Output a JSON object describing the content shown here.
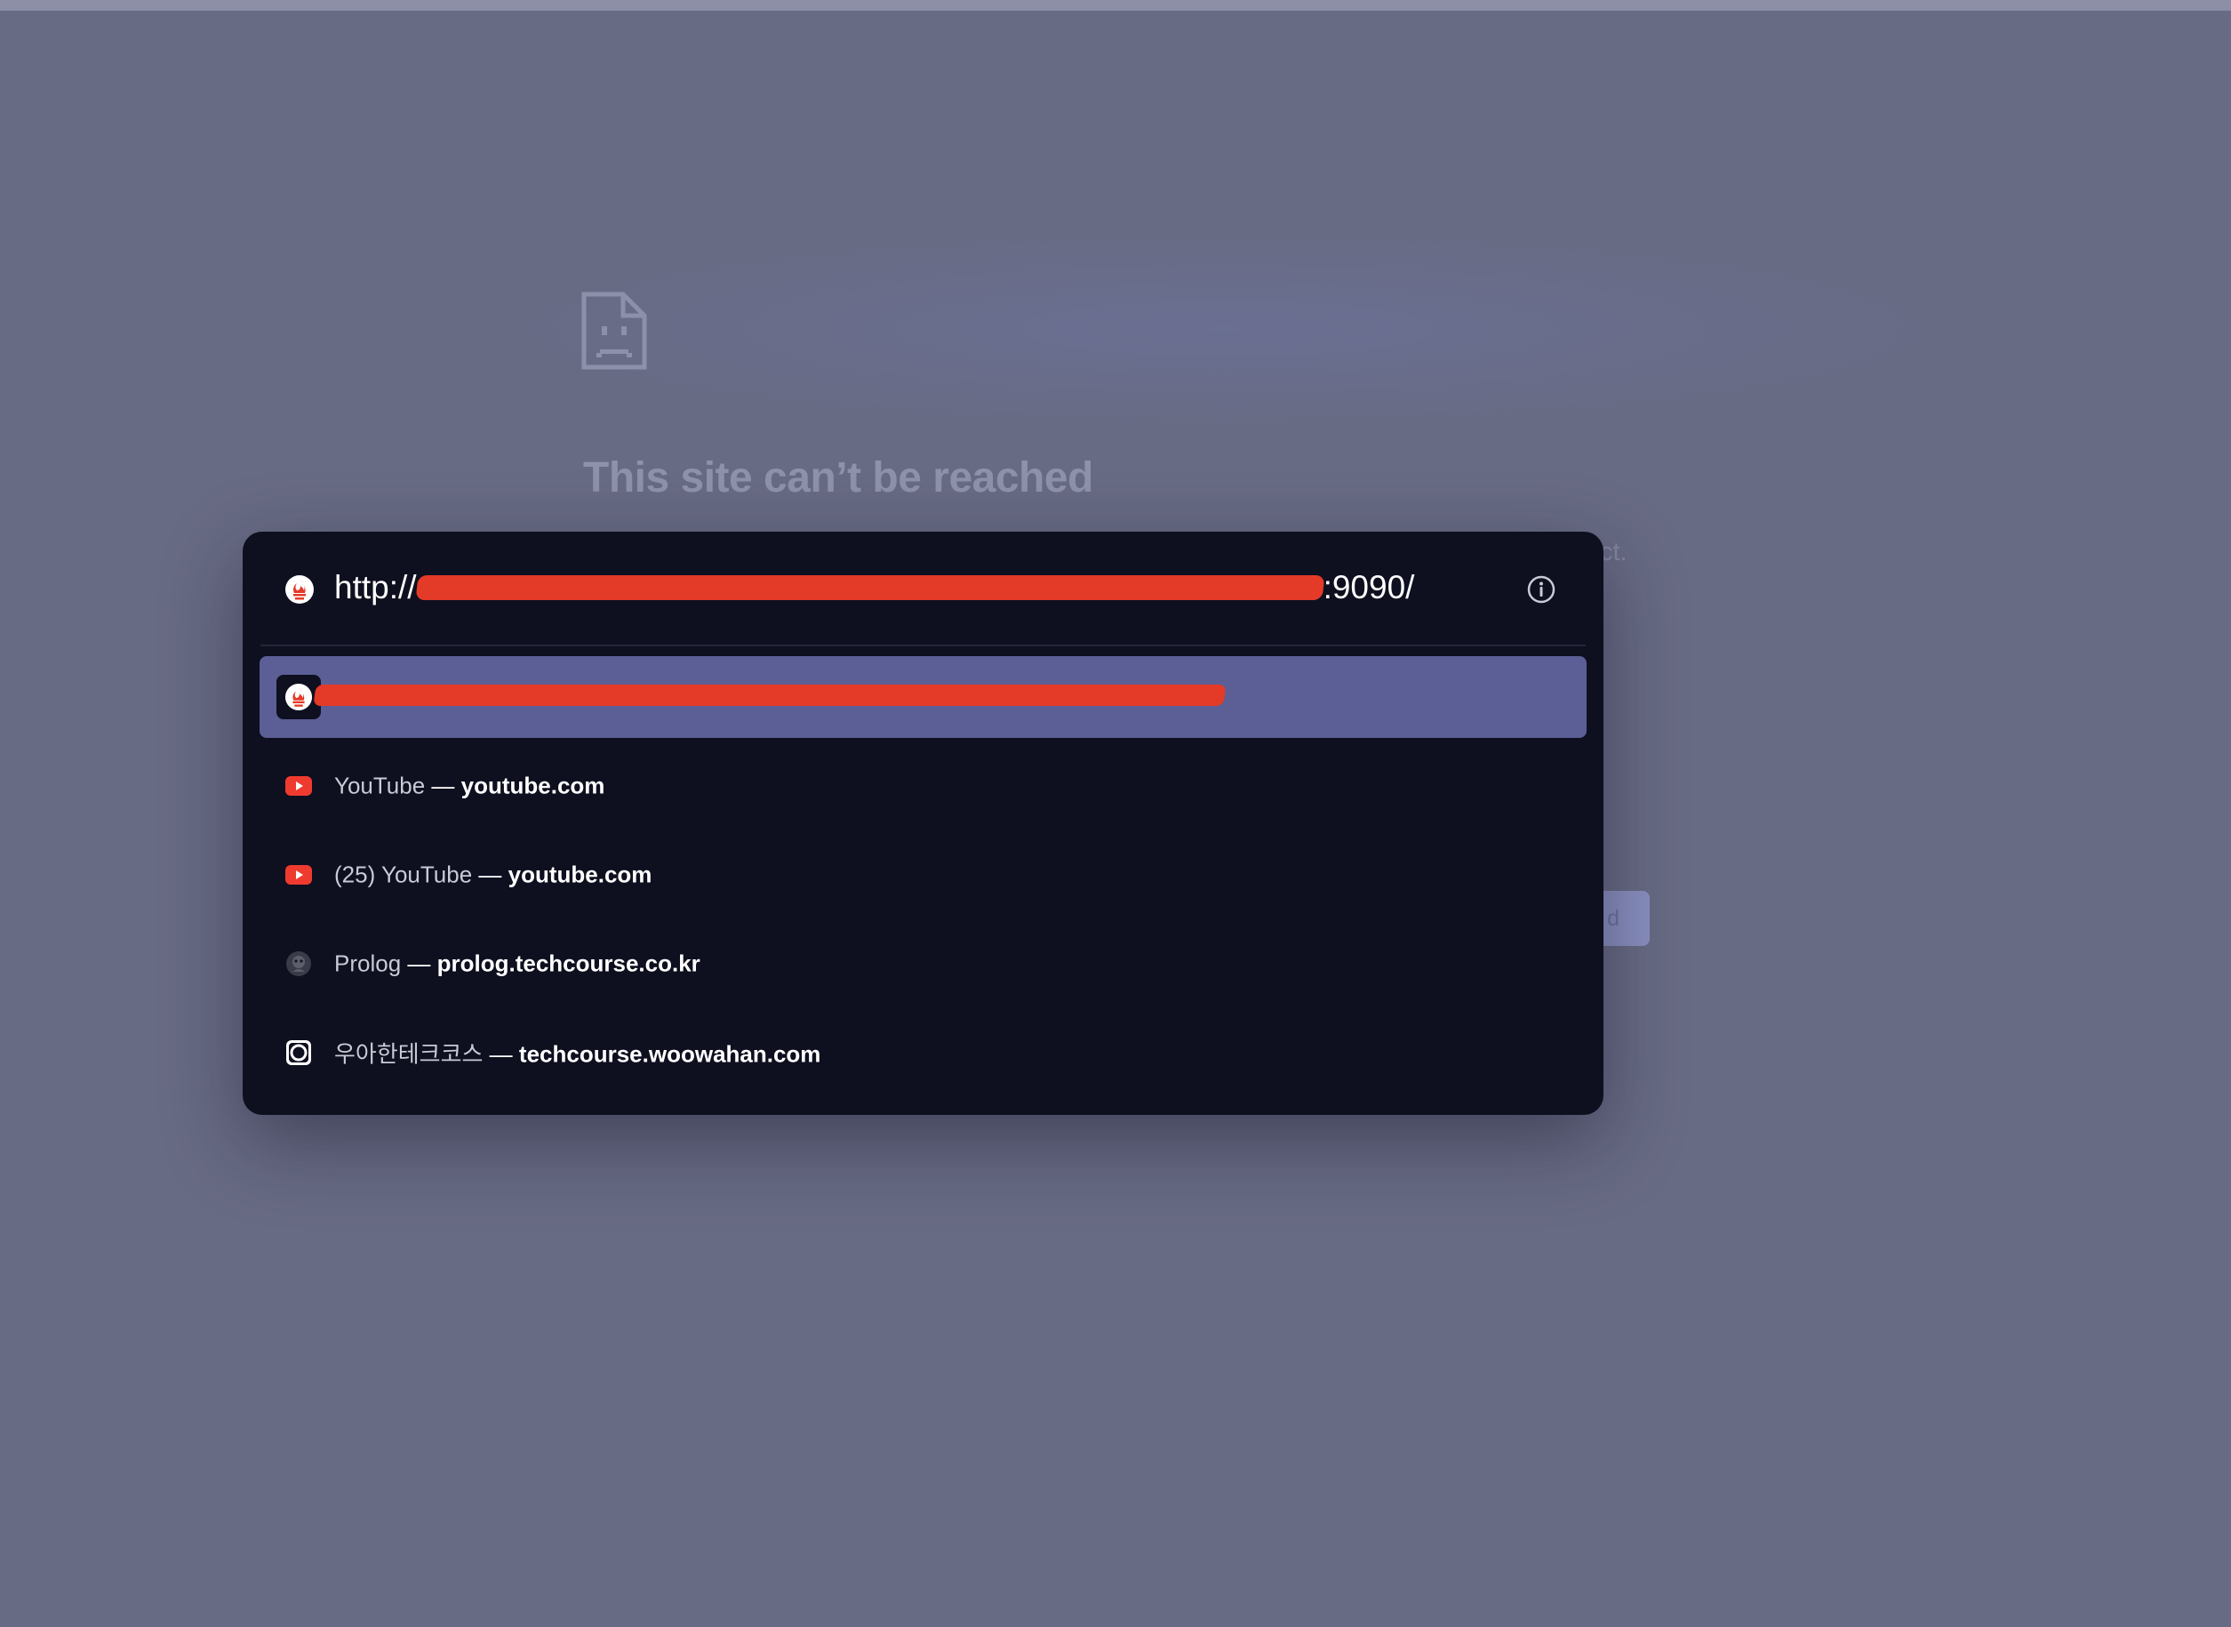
{
  "error_page": {
    "title": "This site can’t be reached",
    "text_fragment": "ct.",
    "button_fragment": "d"
  },
  "palette": {
    "url": {
      "prefix": "http://",
      "suffix": ":9090/",
      "favicon": "red-flame-favicon-icon",
      "info_icon": "info-circle-icon"
    },
    "suggestions": [
      {
        "title": "",
        "separator": "",
        "domain": "",
        "icon": "red-flame-favicon-icon",
        "selected": true
      },
      {
        "title": "YouTube",
        "separator": " — ",
        "domain": "youtube.com",
        "icon": "youtube-icon"
      },
      {
        "title": "(25) YouTube",
        "separator": " — ",
        "domain": "youtube.com",
        "icon": "youtube-icon"
      },
      {
        "title": "Prolog",
        "separator": " — ",
        "domain": "prolog.techcourse.co.kr",
        "icon": "prolog-avatar-icon"
      },
      {
        "title": "우아한테크코스",
        "separator": " — ",
        "domain": "techcourse.woowahan.com",
        "icon": "woowahan-logo-icon"
      }
    ]
  },
  "colors": {
    "background": "#686b84",
    "palette_bg": "#0e0f1f",
    "selected_row": "#5c5e96",
    "redaction": "#e43a28",
    "youtube_red": "#ef3b2f"
  }
}
